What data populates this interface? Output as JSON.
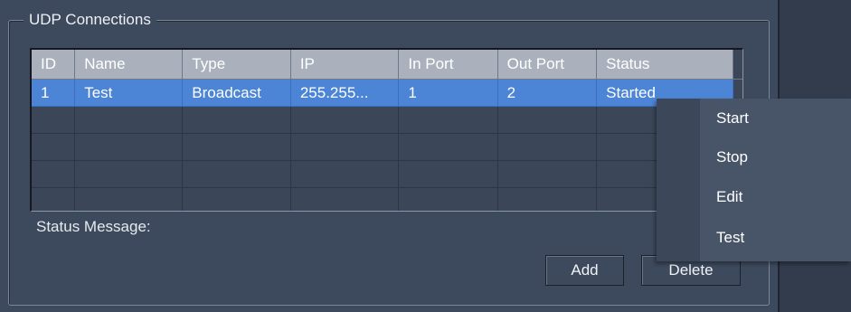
{
  "group": {
    "title": "UDP Connections"
  },
  "table": {
    "columns": [
      "ID",
      "Name",
      "Type",
      "IP",
      "In Port",
      "Out Port",
      "Status"
    ],
    "rows": [
      [
        "1",
        "Test",
        "Broadcast",
        "255.255...",
        "1",
        "2",
        "Started"
      ]
    ],
    "selected_row": 0
  },
  "status_message": {
    "label": "Status Message:"
  },
  "buttons": {
    "add": "Add",
    "delete": "Delete"
  },
  "context_menu": {
    "items": [
      "Start",
      "Stop",
      "Edit",
      "Test"
    ]
  },
  "colors": {
    "panel_bg": "#3d4a5d",
    "header_bg": "#aab1bd",
    "selection": "#4c84d6",
    "menu_bg": "#485569"
  }
}
